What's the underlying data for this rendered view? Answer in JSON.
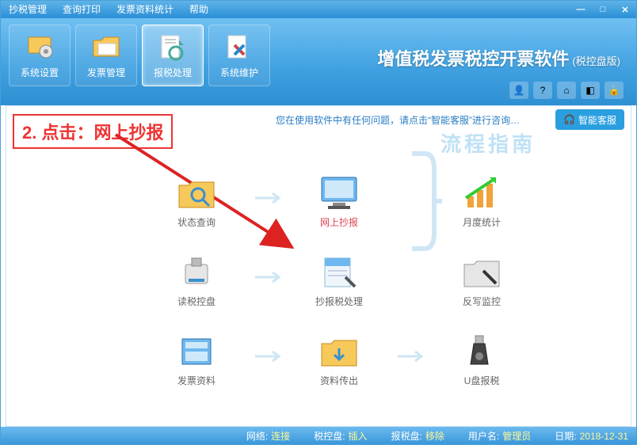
{
  "menu": [
    "抄税管理",
    "查询打印",
    "发票资料统计",
    "帮助"
  ],
  "toolbar": [
    {
      "label": "系统设置",
      "icon": "settings"
    },
    {
      "label": "发票管理",
      "icon": "folder"
    },
    {
      "label": "报税处理",
      "icon": "tax",
      "selected": true
    },
    {
      "label": "系统维护",
      "icon": "maintain"
    }
  ],
  "app_title": "增值税发票税控开票软件",
  "app_subtitle": "(税控盘版)",
  "notice": "您在使用软件中有任何问题，请点击“智能客服”进行咨询…",
  "smart_cs": "智能客服",
  "callout": "2. 点击：网上抄报",
  "flow_title": "流程指南",
  "grid": [
    [
      "状态查询",
      "网上抄报",
      "月度统计"
    ],
    [
      "读税控盘",
      "抄报税处理",
      "反写监控"
    ],
    [
      "发票资料",
      "资料传出",
      "U盘报税"
    ]
  ],
  "grid_active": [
    0,
    1
  ],
  "status": {
    "network_label": "网络:",
    "network_value": "连接",
    "dev_label": "税控盘:",
    "dev_value": "插入",
    "report_label": "报税盘:",
    "report_value": "移除",
    "user_label": "用户名:",
    "user_value": "管理员",
    "date_label": "日期:",
    "date_value": "2018-12-31"
  }
}
